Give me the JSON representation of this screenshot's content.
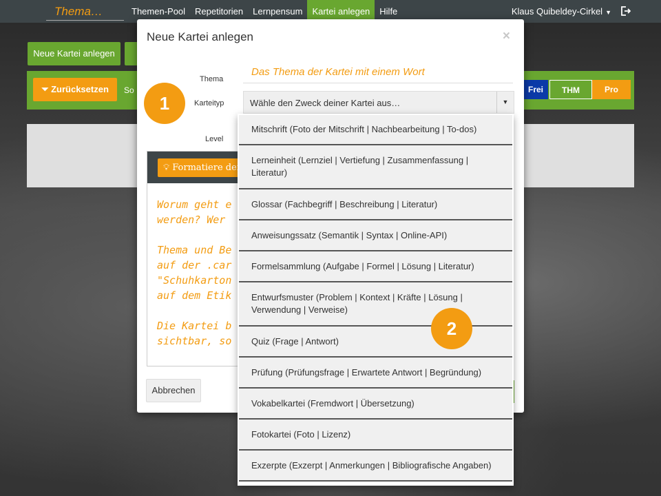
{
  "nav": {
    "brand": "Thema…",
    "items": [
      "Themen-Pool",
      "Repetitorien",
      "Lernpensum",
      "Kartei anlegen",
      "Hilfe"
    ],
    "active_index": 3,
    "user": "Klaus Quibeldey-Cirkel",
    "logout_icon": "logout-icon"
  },
  "background": {
    "new_button": "Neue Kartei anlegen",
    "reset_button": "Zurücksetzen",
    "sort_label": "So",
    "chips": [
      "Frei",
      "THM",
      "Pro"
    ]
  },
  "modal": {
    "title": "Neue Kartei anlegen",
    "close": "×",
    "labels": {
      "thema": "Thema",
      "karteityp": "Karteityp",
      "level": "Level"
    },
    "thema_placeholder": "Das Thema der Kartei mit einem Wort",
    "select_value": "Wähle den Zweck deiner Kartei aus…",
    "format_button": "Formatiere deine",
    "editor_lines": [
      "Worum geht e",
      "werden? Wer ",
      "",
      "Thema und Be",
      "auf der .car",
      "\"Schuhkarton",
      "auf dem Etik",
      "",
      "Die Kartei b",
      "sichtbar, so"
    ],
    "cancel_button": "Abbrechen"
  },
  "badges": [
    "1",
    "2"
  ],
  "dropdown": {
    "options": [
      "Mitschrift (Foto der Mitschrift | Nachbearbeitung | To-dos)",
      "Lerneinheit (Lernziel | Vertiefung | Zusammenfassung | Literatur)",
      "Glossar (Fachbegriff | Beschreibung | Literatur)",
      "Anweisungssatz (Semantik | Syntax | Online-API)",
      "Formelsammlung (Aufgabe | Formel | Lösung | Literatur)",
      "Entwurfsmuster (Problem | Kontext | Kräfte | Lösung | Verwendung | Verweise)",
      "Quiz (Frage | Antwort)",
      "Prüfung (Prüfungsfrage | Erwartete Antwort | Begründung)",
      "Vokabelkartei (Fremdwort | Übersetzung)",
      "Fotokartei (Foto | Lizenz)",
      "Exzerpte (Exzerpt | Anmerkungen | Bibliografische Angaben)"
    ]
  },
  "colors": {
    "accent": "#f39c12",
    "brand_green": "#69a730",
    "navbar": "#3d4548",
    "chip_blue": "#0b3aa8"
  }
}
